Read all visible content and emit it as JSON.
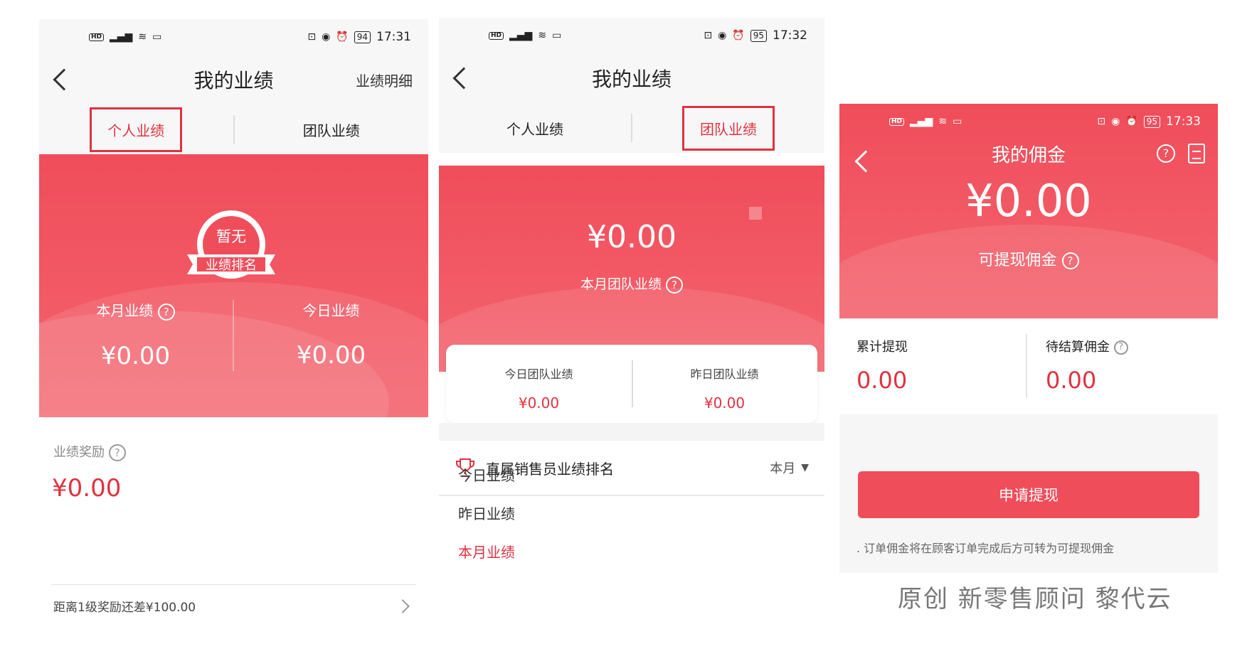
{
  "panel1": {
    "status": {
      "time": "17:31",
      "battery": "94"
    },
    "title": "我的业绩",
    "nav_right": "业绩明细",
    "tabs": [
      "个人业绩",
      "团队业绩"
    ],
    "badge_top": "暂无",
    "badge_bottom": "业绩排名",
    "month_label": "本月业绩",
    "today_label": "今日业绩",
    "month_value": "¥0.00",
    "today_value": "¥0.00",
    "reward_label": "业绩奖励",
    "reward_value": "¥0.00",
    "next_level": "距离1级奖励还差¥100.00"
  },
  "panel2": {
    "status": {
      "time": "17:32",
      "battery": "95"
    },
    "title": "我的业绩",
    "tabs": [
      "个人业绩",
      "团队业绩"
    ],
    "amount": "¥0.00",
    "amount_label": "本月团队业绩",
    "today_label": "今日团队业绩",
    "today_value": "¥0.00",
    "yesterday_label": "昨日团队业绩",
    "yesterday_value": "¥0.00",
    "rank_title": "直属销售员业绩排名",
    "rank_filter": "本月",
    "list": [
      "今日业绩",
      "昨日业绩",
      "本月业绩"
    ]
  },
  "panel3": {
    "status": {
      "time": "17:33",
      "battery": "95"
    },
    "title": "我的佣金",
    "amount": "¥0.00",
    "amount_label": "可提现佣金",
    "total_label": "累计提现",
    "total_value": "0.00",
    "pending_label": "待结算佣金",
    "pending_value": "0.00",
    "button": "申请提现",
    "note": ". 订单佣金将在顾客订单完成后方可转为可提现佣金"
  },
  "watermark": "原创  新零售顾问  黎代云",
  "colors": {
    "accent": "#e0323f",
    "panel_red": "#f04d5a"
  }
}
